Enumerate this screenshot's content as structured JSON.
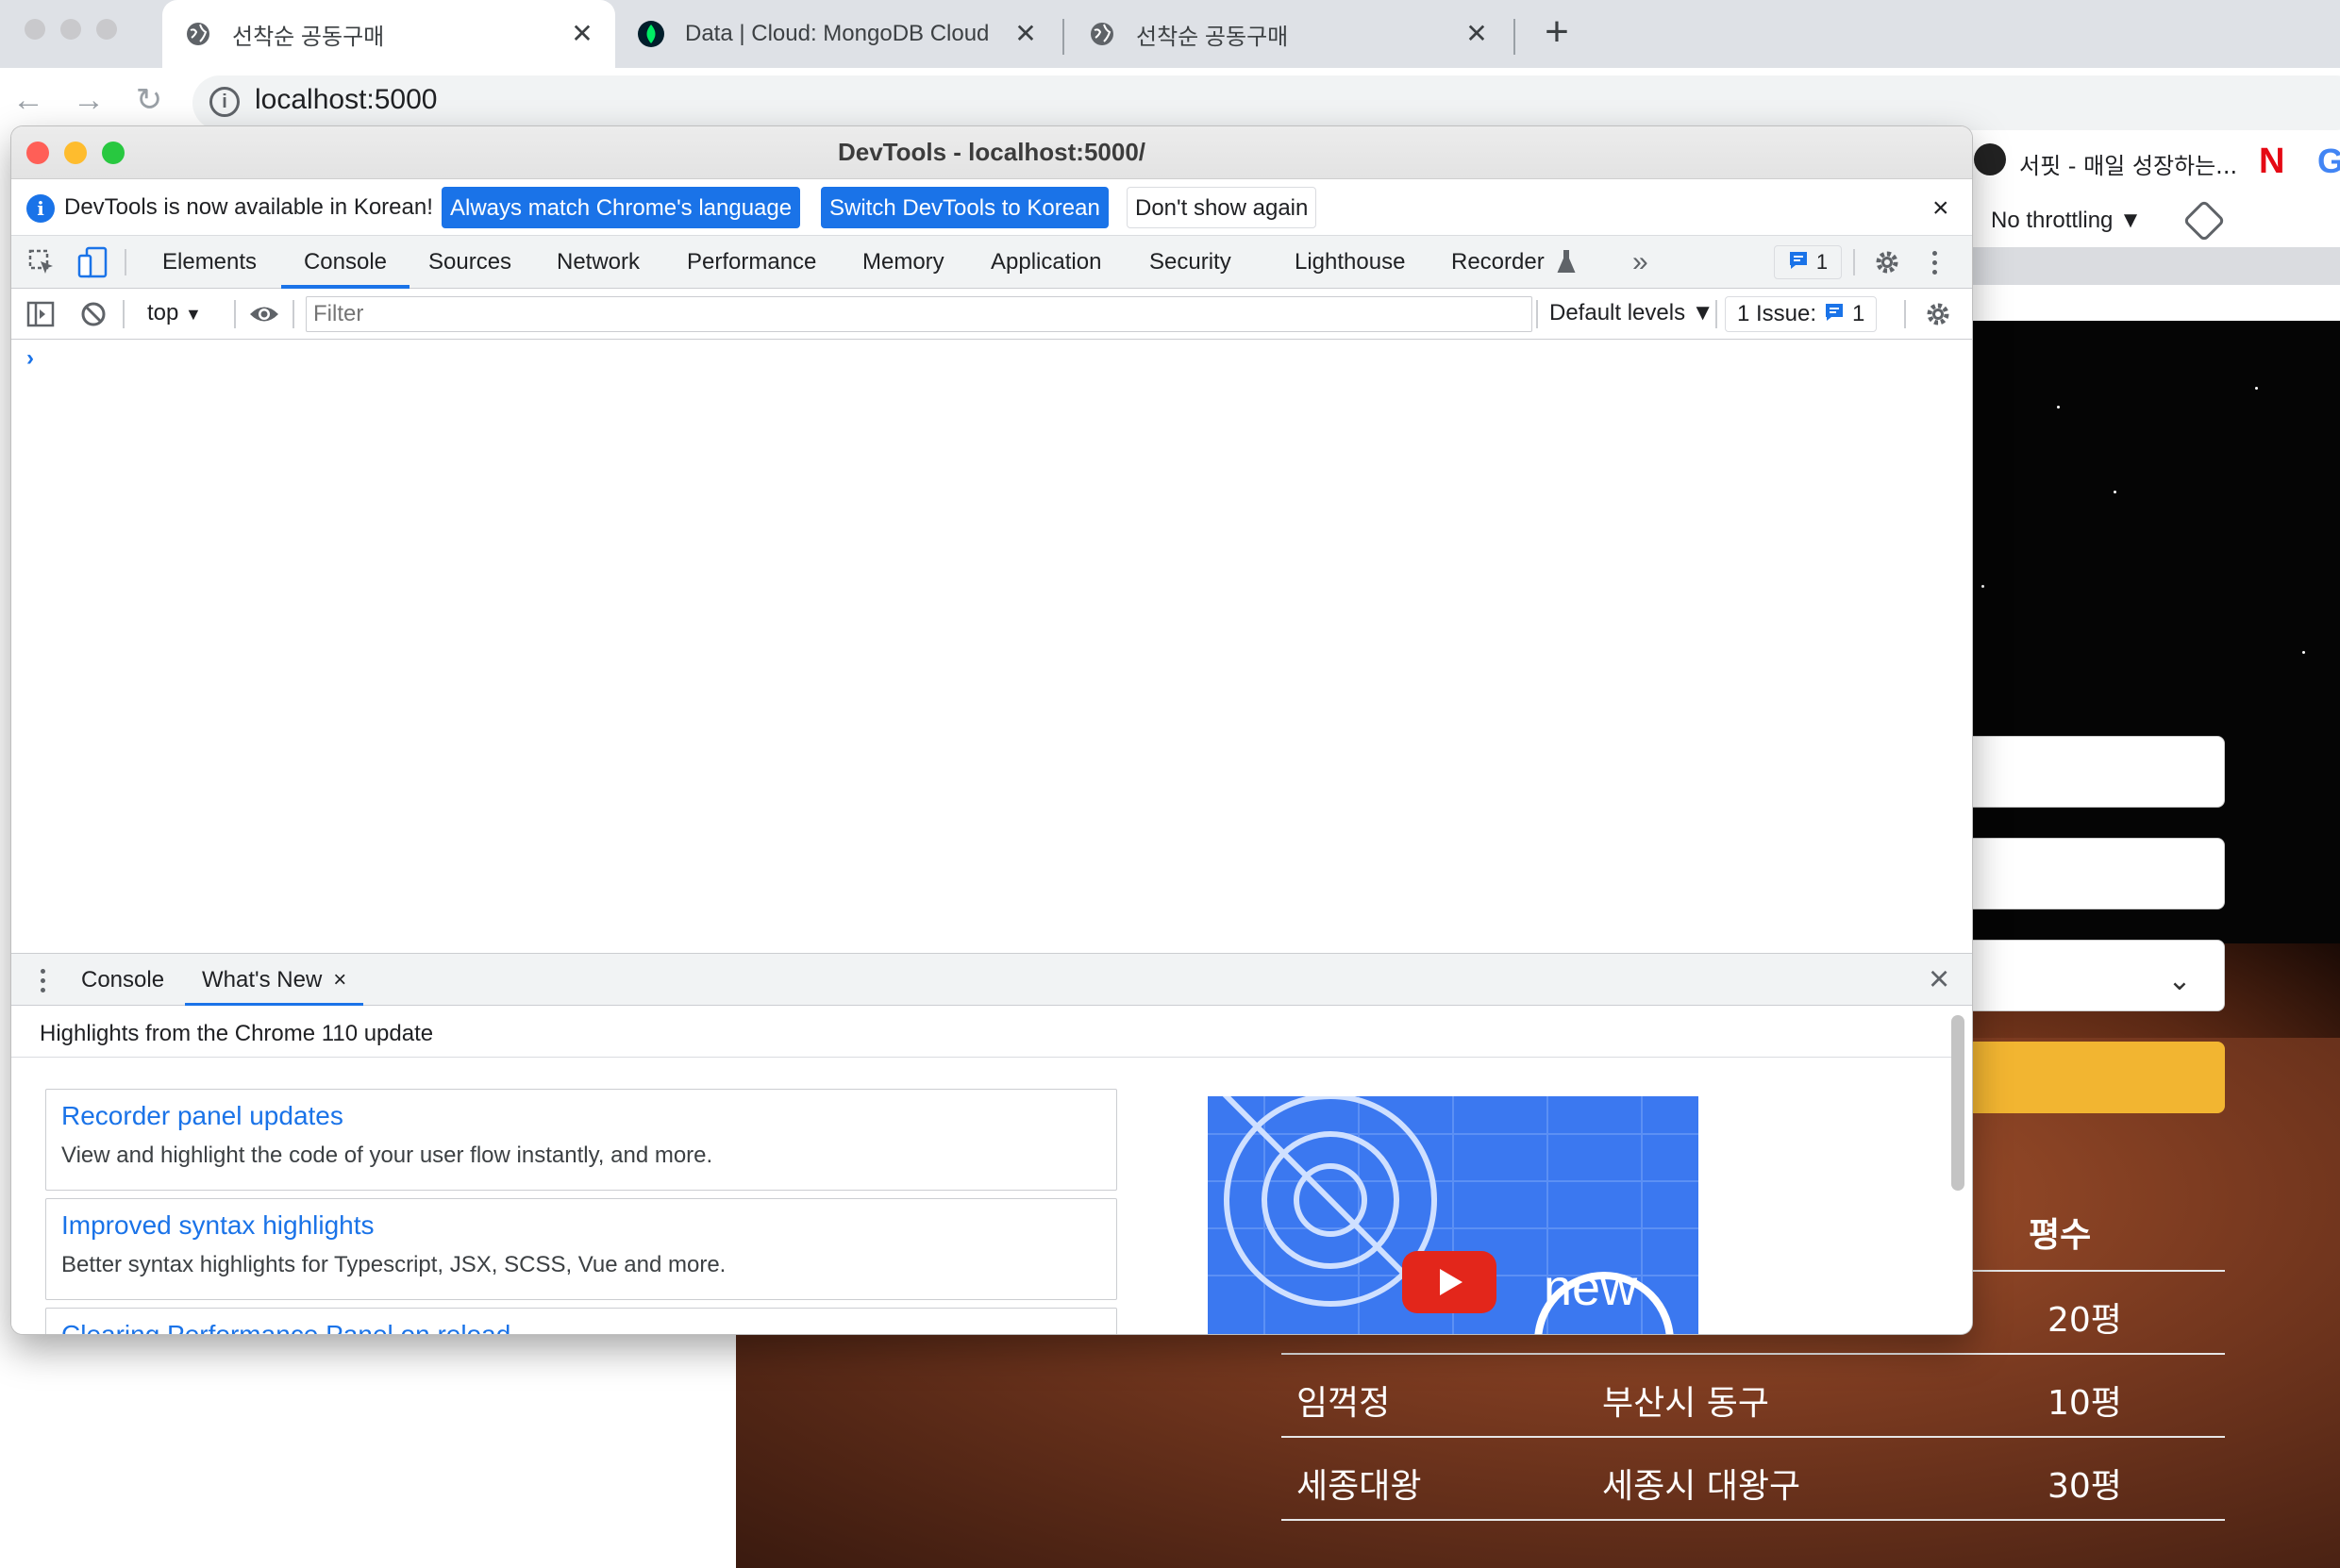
{
  "browser": {
    "tabs": [
      {
        "label": "선착순 공동구매",
        "active": true
      },
      {
        "label": "Data | Cloud: MongoDB Cloud",
        "active": false
      },
      {
        "label": "선착순 공동구매",
        "active": false
      }
    ],
    "new_tab_label": "+",
    "url": "localhost:5000",
    "bookmarks": {
      "surfit": "서핏 - 매일 성장하는...",
      "netflix": "N",
      "google": "G"
    },
    "throttling": "No throttling ▼"
  },
  "devtools": {
    "window_title": "DevTools - localhost:5000/",
    "infobar": {
      "message": "DevTools is now available in Korean!",
      "btn_match": "Always match Chrome's language",
      "btn_switch": "Switch DevTools to Korean",
      "btn_dismiss": "Don't show again",
      "close": "×"
    },
    "tabs": [
      "Elements",
      "Console",
      "Sources",
      "Network",
      "Performance",
      "Memory",
      "Application",
      "Security",
      "Lighthouse",
      "Recorder"
    ],
    "selected_tab": "Console",
    "more_tabs": "»",
    "issues_badge_count": "1",
    "console": {
      "context": "top",
      "filter_placeholder": "Filter",
      "levels": "Default levels ▼",
      "issues_label": "1 Issue:",
      "issues_count": "1",
      "prompt": "›"
    },
    "drawer": {
      "tabs": [
        "Console",
        "What's New"
      ],
      "selected_tab": "What's New",
      "tab_close": "×",
      "close": "×",
      "heading": "Highlights from the Chrome 110 update",
      "items": [
        {
          "title": "Recorder panel updates",
          "desc": "View and highlight the code of your user flow instantly, and more."
        },
        {
          "title": "Improved syntax highlights",
          "desc": "Better syntax highlights for Typescript, JSX, SCSS, Vue and more."
        },
        {
          "title": "Clearing Performance Panel on reload",
          "desc": ""
        }
      ],
      "video_label": "new"
    }
  },
  "page": {
    "table_header": "평수",
    "rows": [
      {
        "name": "",
        "address": "",
        "size": "20평"
      },
      {
        "name": "임꺽정",
        "address": "부산시 동구",
        "size": "10평"
      },
      {
        "name": "세종대왕",
        "address": "세종시 대왕구",
        "size": "30평"
      }
    ]
  },
  "colors": {
    "accent": "#1a73e8",
    "submit": "#f2b531",
    "close": "#ff5f57",
    "minimize": "#febc2e",
    "zoom": "#28c840"
  }
}
